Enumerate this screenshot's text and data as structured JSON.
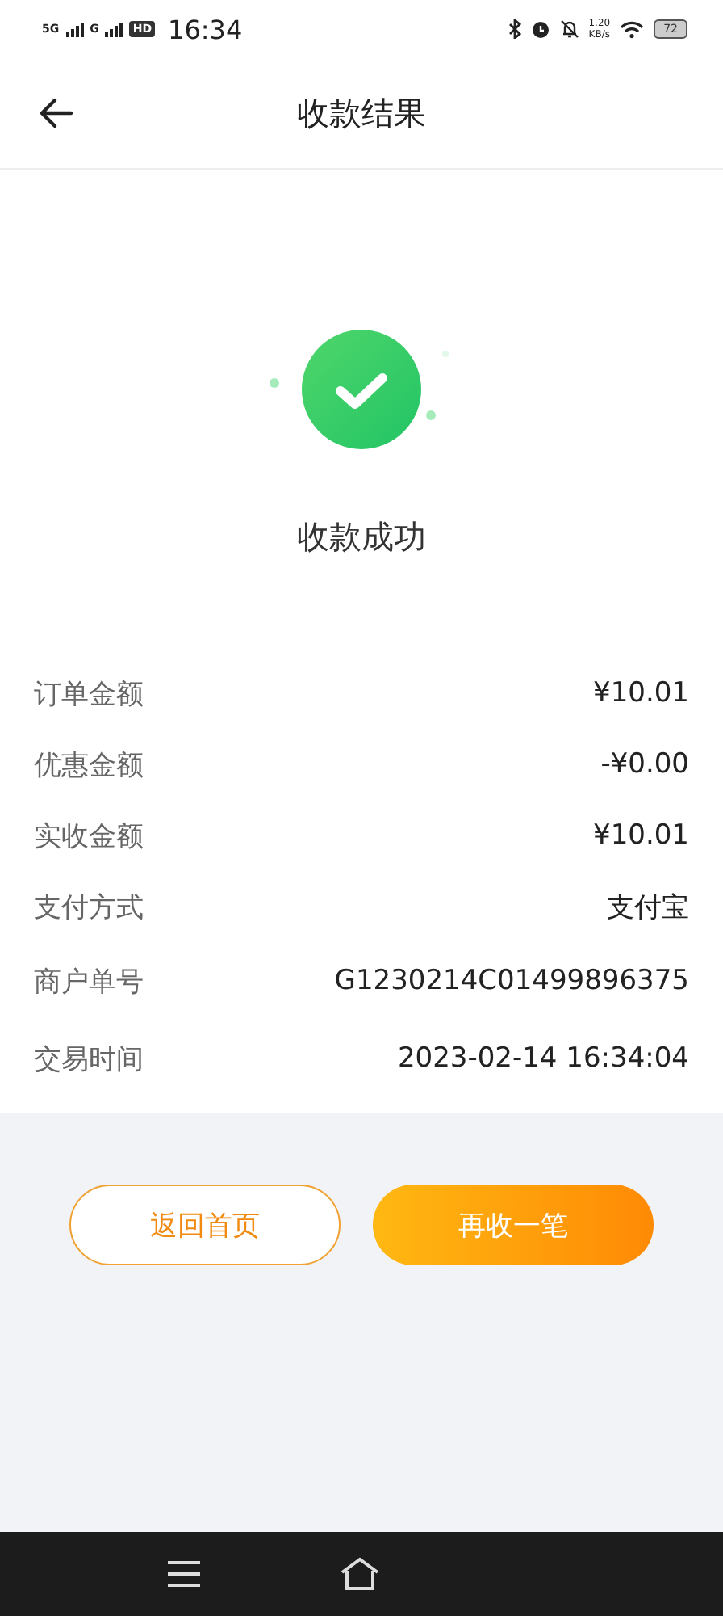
{
  "status_bar": {
    "network_1": "5G",
    "network_2": "G",
    "hd": "HD",
    "time": "16:34",
    "speed": "1.20",
    "speed_unit": "KB/s",
    "battery": "72"
  },
  "header": {
    "title": "收款结果"
  },
  "result": {
    "message": "收款成功"
  },
  "details": [
    {
      "label": "订单金额",
      "value": "¥10.01"
    },
    {
      "label": "优惠金额",
      "value": "-¥0.00"
    },
    {
      "label": "实收金额",
      "value": "¥10.01"
    },
    {
      "label": "支付方式",
      "value": "支付宝"
    },
    {
      "label": "商户单号",
      "value": "G1230214C01499896375"
    },
    {
      "label": "交易时间",
      "value": "2023-02-14 16:34:04"
    }
  ],
  "buttons": [
    {
      "label": "返回首页",
      "kind": "outline"
    },
    {
      "label": "再收一笔",
      "kind": "filled"
    }
  ]
}
